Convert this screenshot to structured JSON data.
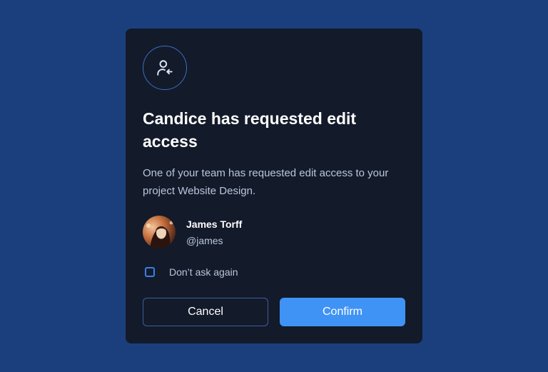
{
  "modal": {
    "icon": "user-arrow-left-icon",
    "title": "Candice has requested edit access",
    "description": "One of your team has requested edit access to your project Website Design.",
    "user": {
      "name": "James Torff",
      "handle": "@james",
      "avatar": "avatar-photo"
    },
    "checkbox": {
      "label": "Don’t ask again",
      "checked": false
    },
    "buttons": {
      "cancel": "Cancel",
      "confirm": "Confirm"
    }
  },
  "colors": {
    "background": "#1b3f7c",
    "modal": "#131a2a",
    "accent": "#3f93f5",
    "muted_text": "#b9c6dc"
  }
}
